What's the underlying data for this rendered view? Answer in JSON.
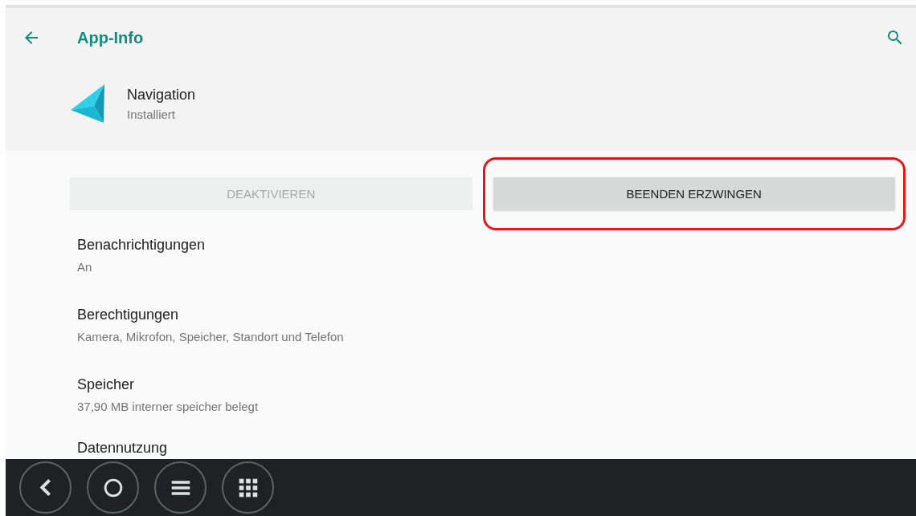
{
  "toolbar": {
    "title": "App-Info"
  },
  "app": {
    "name": "Navigation",
    "status": "Installiert"
  },
  "buttons": [
    {
      "label": "DEAKTIVIEREN",
      "disabled": true,
      "highlighted": false
    },
    {
      "label": "BEENDEN ERZWINGEN",
      "disabled": false,
      "highlighted": true
    }
  ],
  "settings": [
    {
      "title": "Benachrichtigungen",
      "summary": "An"
    },
    {
      "title": "Berechtigungen",
      "summary": "Kamera, Mikrofon, Speicher, Standort und Telefon"
    },
    {
      "title": "Speicher",
      "summary": "37,90 MB interner speicher belegt"
    },
    {
      "title": "Datennutzung"
    }
  ],
  "nav_bar": [
    {
      "kind": "back"
    },
    {
      "kind": "home"
    },
    {
      "kind": "menu"
    },
    {
      "kind": "apps"
    }
  ]
}
